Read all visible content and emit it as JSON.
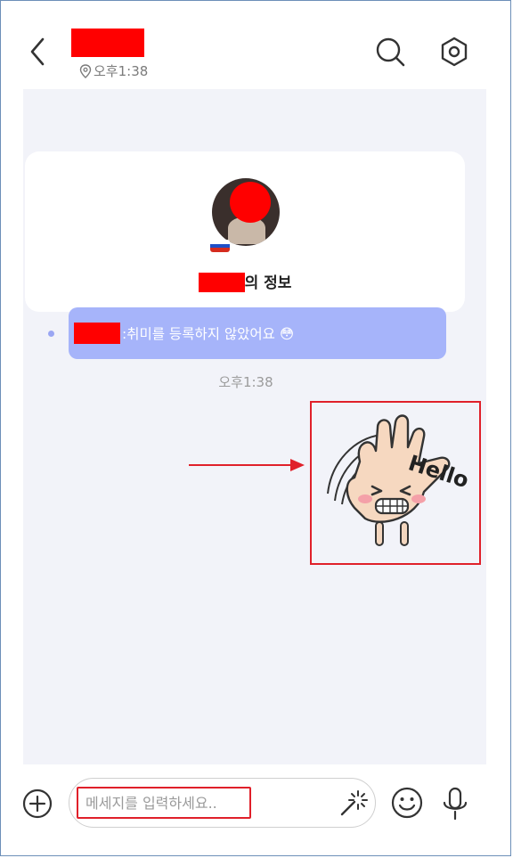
{
  "header": {
    "location_time": "오후1:38",
    "icons": [
      "back-chevron-icon",
      "location-pin-icon",
      "search-icon",
      "settings-hexagon-icon"
    ]
  },
  "profile_card": {
    "info_title_suffix": "의 정보",
    "hobby_text": ":취미를 등록하지 않았어요 😳",
    "flag": "russia-flag-icon"
  },
  "chat": {
    "timestamp": "오후1:38",
    "sticker": {
      "description": "hand sticker",
      "text": "Hello"
    }
  },
  "composer": {
    "placeholder": "메세지를 입력하세요..",
    "icons": [
      "plus-circle-icon",
      "magic-wand-icon",
      "emoji-icon",
      "microphone-icon"
    ]
  },
  "colors": {
    "chat_background": "#f2f3f9",
    "bubble": "#a6b4fa",
    "redaction": "#ff0000",
    "annotation": "#e0202a"
  }
}
